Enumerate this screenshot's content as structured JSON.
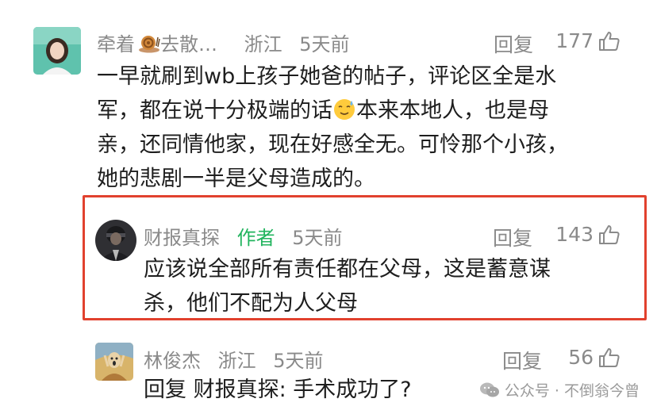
{
  "comments": [
    {
      "username": "牵着",
      "username_suffix": "去散…",
      "location": "浙江",
      "time": "5天前",
      "reply_label": "回复",
      "likes": "177",
      "text_line1": "一早就刷到wb上孩子她爸的帖子，评论区全是水",
      "text_line2a": "军，都在说十分极端的话",
      "text_line2b": "本来本地人，也是母",
      "text_line3": "亲，还同情他家，现在好感全无。可怜那个小孩，",
      "text_line4": "她的悲剧一半是父母造成的。"
    },
    {
      "username": "财报真探",
      "author_badge": "作者",
      "time": "5天前",
      "reply_label": "回复",
      "likes": "143",
      "text_line1": "应该说全部所有责任都在父母，这是蓄意谋",
      "text_line2": "杀，他们不配为人父母"
    },
    {
      "username": "林俊杰",
      "location": "浙江",
      "time": "5天前",
      "reply_label": "回复",
      "likes": "56",
      "text": "回复 财报真探: 手术成功了?"
    }
  ],
  "watermark": {
    "text": "公众号 · 不倒翁今曾"
  },
  "colors": {
    "highlight_border": "#e1412e",
    "author_badge": "#22b45e",
    "meta_gray": "#8a8a8a"
  },
  "icons": [
    "snail-icon",
    "thumbs-up-icon",
    "sweat-smile-emoji-icon",
    "wechat-icon"
  ]
}
